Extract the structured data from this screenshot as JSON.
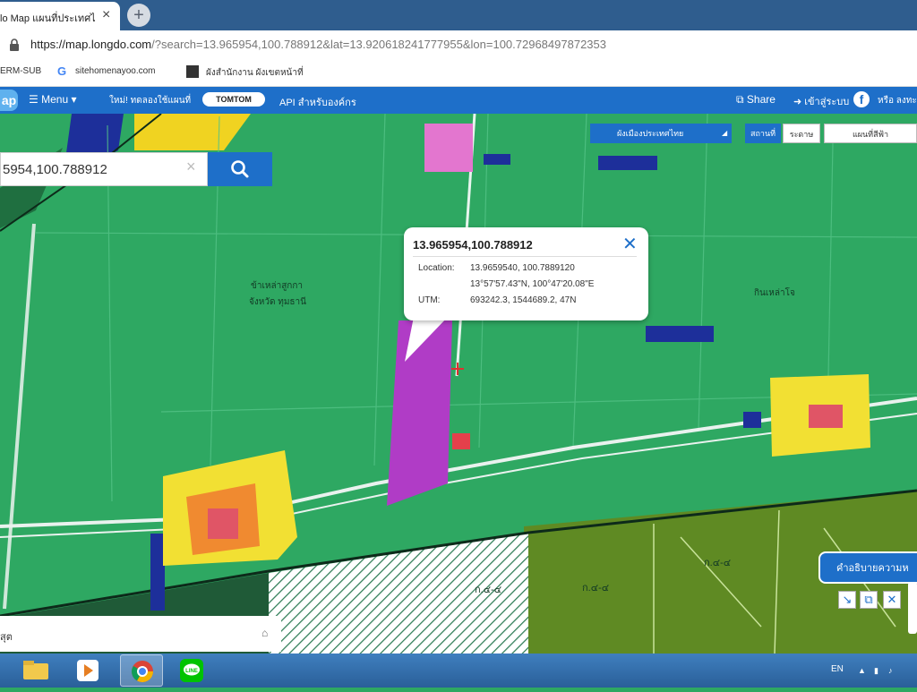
{
  "browser": {
    "tab_title": "lo Map แผนที่ประเทศไ",
    "tab_close": "×",
    "newtab": "+",
    "url_host": "https://map.longdo.com",
    "url_rest": "/?search=13.965954,100.788912&lat=13.920618241777955&lon=100.72968497872353",
    "bookmarks": [
      {
        "label": "ERM-SUB"
      },
      {
        "label": "sitehomenayoo.com"
      },
      {
        "label": "ผังสำนักงาน ผังเขตหน้าที่"
      }
    ]
  },
  "nav": {
    "logo": "ap",
    "menu_label": "Menu ▾",
    "promo_text": "ใหม่! ทดลองใช้แผนที่",
    "tomtom_label": "TOMTOM",
    "api_label": "API สำหรับองค์กร",
    "share_label": "Share",
    "login_label": "เข้าสู่ระบบ",
    "fb_label": "f",
    "or_text": "หรือ ลงทะ"
  },
  "search": {
    "value": "5954,100.788912",
    "clear": "×"
  },
  "map_controls": {
    "layer": "ผังเมืองประเทศไทย",
    "status_label": "สถานที่",
    "status_value": "ระดาษ",
    "map_type": "แผนที่สีฟ้า"
  },
  "popup": {
    "title": "13.965954,100.788912",
    "close": "✕",
    "location_label": "Location:",
    "location_decimal": "13.9659540, 100.7889120",
    "location_dms": "13°57'57.43\"N, 100°47'20.08\"E",
    "utm_label": "UTM:",
    "utm_value": "693242.3, 1544689.2, 47N"
  },
  "map_labels": {
    "area_left_1": "ข้าเหล่าสูกกา",
    "area_left_2": "จังหวัด ทุมธานี",
    "area_right": "กินเหล่าโจ",
    "zone_a": "ก.๔-๔",
    "zone_b": "ก.๔-๔",
    "zone_c": "ก.๔-๔"
  },
  "legend_button": "คำอธิบายความห",
  "map_tools": [
    "↘",
    "⧉",
    "✕"
  ],
  "bottom_panel": {
    "text": "สุต",
    "home": "⌂"
  },
  "taskbar": {
    "lang": "EN",
    "tray": [
      "▲",
      "▮",
      "♪"
    ]
  }
}
